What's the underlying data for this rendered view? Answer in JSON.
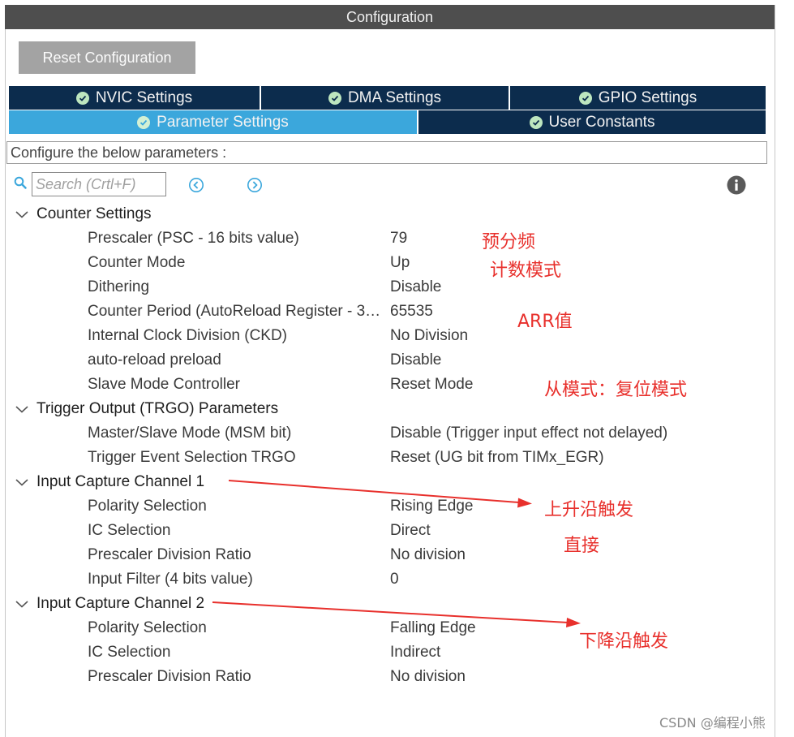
{
  "window": {
    "title": "Configuration"
  },
  "toolbar": {
    "reset_label": "Reset Configuration"
  },
  "tabs": {
    "nvic": "NVIC Settings",
    "dma": "DMA Settings",
    "gpio": "GPIO Settings",
    "parameter": "Parameter Settings",
    "user_constants": "User Constants",
    "active": "parameter"
  },
  "description": "Configure the below parameters :",
  "search": {
    "placeholder": "Search (Crtl+F)",
    "value": ""
  },
  "icons": {
    "search": "search-icon",
    "prev": "circle-chevron-left-icon",
    "next": "circle-chevron-right-icon",
    "info": "info-icon",
    "check": "check-circle-icon",
    "expand": "chevron-down-icon"
  },
  "colors": {
    "title_bar": "#4e4e4e",
    "tab_inactive": "#0c2c4d",
    "tab_active": "#3ba7dc",
    "check_green": "#bde6bf",
    "annotation_red": "#e8302c",
    "nav_blue": "#3ba7dc"
  },
  "groups": {
    "counter": {
      "title": "Counter Settings",
      "params": [
        {
          "name": "Prescaler (PSC - 16 bits value)",
          "value": "79"
        },
        {
          "name": "Counter Mode",
          "value": "Up"
        },
        {
          "name": "Dithering",
          "value": "Disable"
        },
        {
          "name": "Counter Period (AutoReload Register - 3…",
          "value": "65535"
        },
        {
          "name": "Internal Clock Division (CKD)",
          "value": "No Division"
        },
        {
          "name": "auto-reload preload",
          "value": "Disable"
        },
        {
          "name": "Slave Mode Controller",
          "value": "Reset Mode"
        }
      ]
    },
    "trgo": {
      "title": "Trigger Output (TRGO) Parameters",
      "params": [
        {
          "name": "Master/Slave Mode (MSM bit)",
          "value": "Disable (Trigger input effect not delayed)"
        },
        {
          "name": "Trigger Event Selection TRGO",
          "value": "Reset (UG bit from TIMx_EGR)"
        }
      ]
    },
    "ic1": {
      "title": "Input Capture Channel 1",
      "params": [
        {
          "name": "Polarity Selection",
          "value": "Rising Edge"
        },
        {
          "name": "IC Selection",
          "value": "Direct"
        },
        {
          "name": "Prescaler Division Ratio",
          "value": "No division"
        },
        {
          "name": "Input Filter (4 bits value)",
          "value": "0"
        }
      ]
    },
    "ic2": {
      "title": "Input Capture Channel 2",
      "params": [
        {
          "name": "Polarity Selection",
          "value": "Falling Edge"
        },
        {
          "name": "IC Selection",
          "value": "Indirect"
        },
        {
          "name": "Prescaler Division Ratio",
          "value": "No division"
        }
      ]
    }
  },
  "annotations": {
    "prescaler": "预分频",
    "counter_mode": "计数模式",
    "arr": "ARR值",
    "slave_mode": "从模式：复位模式",
    "rising": "上升沿触发",
    "direct": "直接",
    "falling": "下降沿触发"
  },
  "watermark": "CSDN @编程小熊"
}
